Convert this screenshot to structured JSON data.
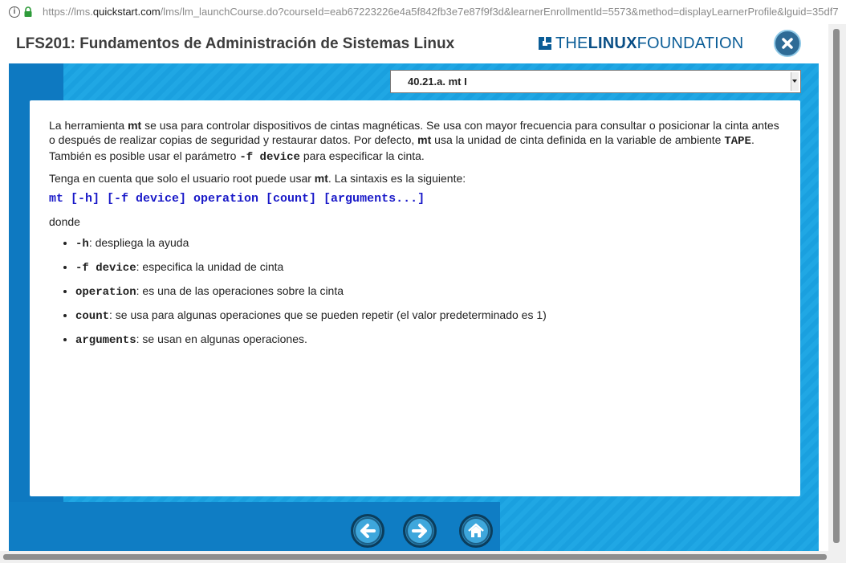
{
  "browser": {
    "url_prefix": "https://lms.",
    "url_domain": "quickstart.com",
    "url_rest": "/lms/lm_launchCourse.do?courseId=eab67223226e4a5f842fb3e7e87f9f3d&learnerEnrollmentId=5573&method=displayLearnerProfile&lguid=35df7"
  },
  "header": {
    "course_title": "LFS201: Fundamentos de Administración de Sistemas Linux",
    "logo_the": "THE",
    "logo_linux": "LINUX",
    "logo_foundation": "FOUNDATION"
  },
  "section_select": {
    "value": "40.21.a. mt I"
  },
  "content": {
    "p1": {
      "t1": "La herramienta ",
      "b1": "mt",
      "t2": " se usa para controlar dispositivos de cintas magnéticas. Se usa con mayor frecuencia para consultar o posicionar la cinta antes o después de realizar copias de seguridad y restaurar datos. Por defecto, ",
      "b2": "mt",
      "t3": " usa la unidad de cinta definida en la variable de ambiente ",
      "m1": "TAPE",
      "t4": ". También es posible usar el parámetro ",
      "m2": "-f device",
      "t5": " para especificar la cinta."
    },
    "p2": {
      "t1": "Tenga en cuenta que solo el usuario root puede usar ",
      "b1": "mt",
      "t2": ". La sintaxis es la siguiente:"
    },
    "syntax": "mt [-h] [-f device] operation [count] [arguments...]",
    "donde": "donde",
    "options": [
      {
        "term": "-h",
        "desc": ":  despliega la ayuda"
      },
      {
        "term": "-f device",
        "desc": ":  especifica la unidad de cinta"
      },
      {
        "term": "operation",
        "desc": ":  es una de las operaciones sobre la cinta"
      },
      {
        "term": "count",
        "desc": ": se usa para algunas operaciones que se pueden repetir (el valor predeterminado es 1)"
      },
      {
        "term": "arguments",
        "desc": ":  se usan en algunas operaciones."
      }
    ]
  },
  "colors": {
    "accent_blue": "#1aa0df",
    "dark_blue": "#0e79c1",
    "syntax_blue": "#1818c8"
  },
  "icons": {
    "back": "arrow-left-icon",
    "next": "arrow-right-icon",
    "home": "home-icon",
    "close": "close-icon"
  }
}
